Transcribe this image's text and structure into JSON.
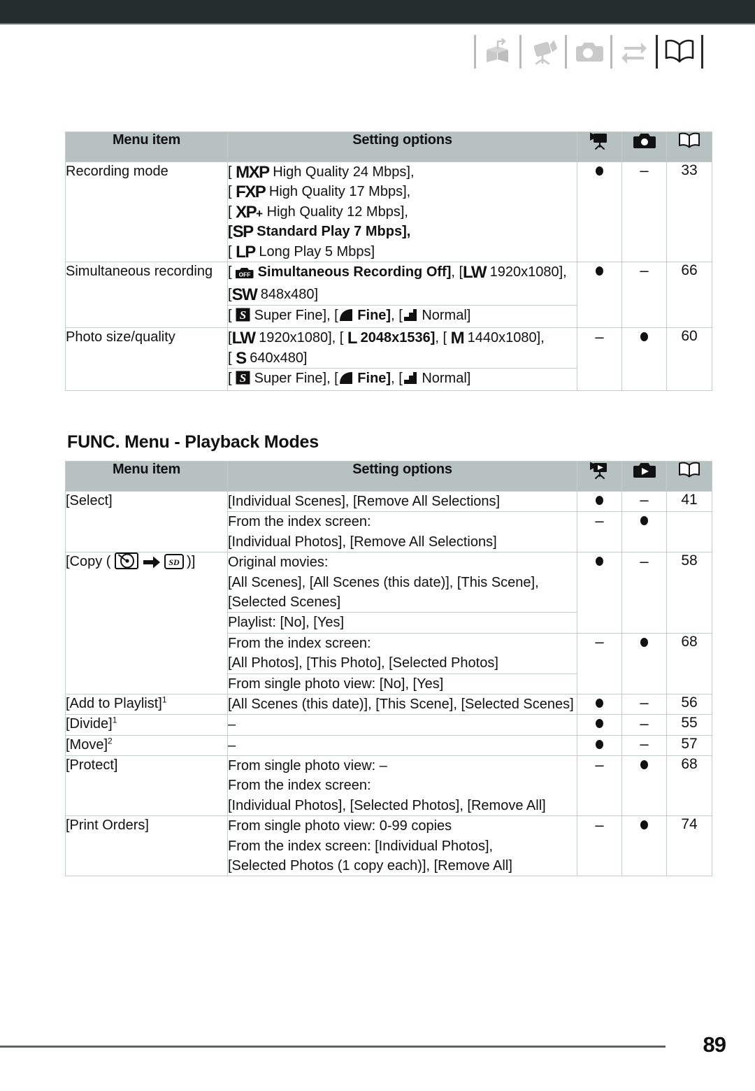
{
  "document": {
    "page_number": "89"
  },
  "header": {
    "tabs": [
      {
        "name": "open-box-icon",
        "state": "inactive"
      },
      {
        "name": "camcorder-icon",
        "state": "inactive"
      },
      {
        "name": "camera-icon",
        "state": "inactive"
      },
      {
        "name": "transfer-arrows-icon",
        "state": "inactive"
      },
      {
        "name": "open-book-icon",
        "state": "active"
      }
    ]
  },
  "table_record": {
    "columns": {
      "item": "Menu item",
      "options": "Setting options",
      "mode_movie": "camcorder-record-icon",
      "mode_photo": "camera-record-icon",
      "page": "open-book-icon"
    },
    "rows": [
      {
        "item": "Recording mode",
        "option_blocks": [
          {
            "lines": [
              {
                "parts": [
                  {
                    "t": "text",
                    "v": "[ "
                  },
                  {
                    "t": "badge",
                    "v": "MXP"
                  },
                  {
                    "t": "text",
                    "v": " High Quality 24 Mbps],"
                  }
                ]
              },
              {
                "parts": [
                  {
                    "t": "text",
                    "v": "[ "
                  },
                  {
                    "t": "badge",
                    "v": "FXP"
                  },
                  {
                    "t": "text",
                    "v": " High Quality 17 Mbps],"
                  }
                ]
              },
              {
                "parts": [
                  {
                    "t": "text",
                    "v": "[ "
                  },
                  {
                    "t": "badge",
                    "v": "XP+"
                  },
                  {
                    "t": "text",
                    "v": " High Quality 12 Mbps],"
                  }
                ]
              },
              {
                "bold": true,
                "parts": [
                  {
                    "t": "text",
                    "v": "["
                  },
                  {
                    "t": "badge",
                    "v": "SP"
                  },
                  {
                    "t": "text",
                    "v": " Standard Play 7 Mbps],"
                  }
                ]
              },
              {
                "parts": [
                  {
                    "t": "text",
                    "v": "[ "
                  },
                  {
                    "t": "badge",
                    "v": "LP"
                  },
                  {
                    "t": "text",
                    "v": " Long Play 5 Mbps]"
                  }
                ]
              }
            ]
          }
        ],
        "mode_movie": "●",
        "mode_photo": "–",
        "page": "33"
      },
      {
        "item": "Simultaneous recording",
        "option_blocks": [
          {
            "lines": [
              {
                "parts": [
                  {
                    "t": "text",
                    "v": "[ "
                  },
                  {
                    "t": "icon",
                    "v": "off-camera-icon"
                  },
                  {
                    "t": "btext",
                    "v": " Simultaneous Recording Off]"
                  },
                  {
                    "t": "text",
                    "v": ", ["
                  },
                  {
                    "t": "badge",
                    "v": "LW"
                  },
                  {
                    "t": "text",
                    "v": " 1920x1080],"
                  }
                ]
              },
              {
                "parts": [
                  {
                    "t": "text",
                    "v": "["
                  },
                  {
                    "t": "badge",
                    "v": "SW"
                  },
                  {
                    "t": "text",
                    "v": " 848x480]"
                  }
                ]
              }
            ]
          },
          {
            "lines": [
              {
                "parts": [
                  {
                    "t": "text",
                    "v": "[ "
                  },
                  {
                    "t": "icon",
                    "v": "super-fine-icon"
                  },
                  {
                    "t": "text",
                    "v": " Super Fine], ["
                  },
                  {
                    "t": "icon",
                    "v": "fine-icon"
                  },
                  {
                    "t": "btext",
                    "v": " Fine]"
                  },
                  {
                    "t": "text",
                    "v": ", ["
                  },
                  {
                    "t": "icon",
                    "v": "normal-icon"
                  },
                  {
                    "t": "text",
                    "v": " Normal]"
                  }
                ]
              }
            ]
          }
        ],
        "mode_movie": "●",
        "mode_photo": "–",
        "page": "66"
      },
      {
        "item": "Photo size/quality",
        "option_blocks": [
          {
            "lines": [
              {
                "parts": [
                  {
                    "t": "text",
                    "v": "["
                  },
                  {
                    "t": "badge",
                    "v": "LW"
                  },
                  {
                    "t": "text",
                    "v": " 1920x1080], [ "
                  },
                  {
                    "t": "badge",
                    "v": "L"
                  },
                  {
                    "t": "btext",
                    "v": " 2048x1536]"
                  },
                  {
                    "t": "text",
                    "v": ", [ "
                  },
                  {
                    "t": "badge",
                    "v": "M"
                  },
                  {
                    "t": "text",
                    "v": " 1440x1080],"
                  }
                ]
              },
              {
                "parts": [
                  {
                    "t": "text",
                    "v": "[ "
                  },
                  {
                    "t": "badge",
                    "v": "S"
                  },
                  {
                    "t": "text",
                    "v": " 640x480]"
                  }
                ]
              }
            ]
          },
          {
            "lines": [
              {
                "parts": [
                  {
                    "t": "text",
                    "v": "[ "
                  },
                  {
                    "t": "icon",
                    "v": "super-fine-icon"
                  },
                  {
                    "t": "text",
                    "v": " Super Fine], ["
                  },
                  {
                    "t": "icon",
                    "v": "fine-icon"
                  },
                  {
                    "t": "btext",
                    "v": " Fine]"
                  },
                  {
                    "t": "text",
                    "v": ", ["
                  },
                  {
                    "t": "icon",
                    "v": "normal-icon"
                  },
                  {
                    "t": "text",
                    "v": " Normal]"
                  }
                ]
              }
            ]
          }
        ],
        "mode_movie": "–",
        "mode_photo": "●",
        "page": "60"
      }
    ]
  },
  "section_playback": {
    "heading": "FUNC. Menu - Playback Modes"
  },
  "table_playback": {
    "columns": {
      "item": "Menu item",
      "options": "Setting options",
      "mode_movie": "camcorder-playback-icon",
      "mode_photo": "camera-playback-icon",
      "page": "open-book-icon"
    },
    "rows": [
      {
        "item": "[Select]",
        "groups": [
          {
            "blocks": [
              {
                "lines": [
                  {
                    "parts": [
                      {
                        "t": "text",
                        "v": "[Individual Scenes], [Remove All Selections]"
                      }
                    ]
                  }
                ]
              }
            ],
            "mode_movie": "●",
            "mode_photo": "–",
            "page": "41"
          },
          {
            "blocks": [
              {
                "lines": [
                  {
                    "parts": [
                      {
                        "t": "text",
                        "v": "From the index screen:"
                      }
                    ]
                  },
                  {
                    "parts": [
                      {
                        "t": "text",
                        "v": "[Individual Photos], [Remove All Selections]"
                      }
                    ]
                  }
                ]
              }
            ],
            "mode_movie": "–",
            "mode_photo": "●",
            "page": ""
          }
        ]
      },
      {
        "item_parts": [
          {
            "t": "text",
            "v": "[Copy ( "
          },
          {
            "t": "icon",
            "v": "hard-disk-icon"
          },
          {
            "t": "text",
            "v": " "
          },
          {
            "t": "icon",
            "v": "right-arrow-icon"
          },
          {
            "t": "text",
            "v": " "
          },
          {
            "t": "icon",
            "v": "sd-card-icon"
          },
          {
            "t": "text",
            "v": ")]"
          }
        ],
        "groups": [
          {
            "blocks": [
              {
                "lines": [
                  {
                    "parts": [
                      {
                        "t": "text",
                        "v": "Original movies:"
                      }
                    ]
                  },
                  {
                    "parts": [
                      {
                        "t": "text",
                        "v": "[All Scenes], [All Scenes (this date)], [This Scene],"
                      }
                    ]
                  },
                  {
                    "parts": [
                      {
                        "t": "text",
                        "v": "[Selected Scenes]"
                      }
                    ]
                  }
                ]
              },
              {
                "lines": [
                  {
                    "parts": [
                      {
                        "t": "text",
                        "v": "Playlist: [No], [Yes]"
                      }
                    ]
                  }
                ]
              }
            ],
            "mode_movie": "●",
            "mode_photo": "–",
            "page": "58"
          },
          {
            "blocks": [
              {
                "lines": [
                  {
                    "parts": [
                      {
                        "t": "text",
                        "v": "From the index screen:"
                      }
                    ]
                  },
                  {
                    "parts": [
                      {
                        "t": "text",
                        "v": "[All Photos], [This Photo], [Selected Photos]"
                      }
                    ]
                  }
                ]
              },
              {
                "lines": [
                  {
                    "parts": [
                      {
                        "t": "text",
                        "v": "From single photo view: [No], [Yes]"
                      }
                    ]
                  }
                ]
              }
            ],
            "mode_movie": "–",
            "mode_photo": "●",
            "page": "68"
          }
        ]
      },
      {
        "item_parts": [
          {
            "t": "text",
            "v": "[Add to Playlist]"
          },
          {
            "t": "sup",
            "v": "1"
          }
        ],
        "groups": [
          {
            "blocks": [
              {
                "lines": [
                  {
                    "parts": [
                      {
                        "t": "text",
                        "v": "[All Scenes (this date)], [This Scene], [Selected Scenes]"
                      }
                    ]
                  }
                ]
              }
            ],
            "mode_movie": "●",
            "mode_photo": "–",
            "page": "56"
          }
        ]
      },
      {
        "item_parts": [
          {
            "t": "text",
            "v": "[Divide]"
          },
          {
            "t": "sup",
            "v": "1"
          }
        ],
        "groups": [
          {
            "blocks": [
              {
                "lines": [
                  {
                    "parts": [
                      {
                        "t": "text",
                        "v": "–"
                      }
                    ]
                  }
                ]
              }
            ],
            "mode_movie": "●",
            "mode_photo": "–",
            "page": "55"
          }
        ]
      },
      {
        "item_parts": [
          {
            "t": "text",
            "v": "[Move]"
          },
          {
            "t": "sup",
            "v": "2"
          }
        ],
        "groups": [
          {
            "blocks": [
              {
                "lines": [
                  {
                    "parts": [
                      {
                        "t": "text",
                        "v": "–"
                      }
                    ]
                  }
                ]
              }
            ],
            "mode_movie": "●",
            "mode_photo": "–",
            "page": "57"
          }
        ]
      },
      {
        "item": "[Protect]",
        "groups": [
          {
            "blocks": [
              {
                "lines": [
                  {
                    "parts": [
                      {
                        "t": "text",
                        "v": "From single photo view: –"
                      }
                    ]
                  },
                  {
                    "parts": [
                      {
                        "t": "text",
                        "v": "From the index screen:"
                      }
                    ]
                  },
                  {
                    "parts": [
                      {
                        "t": "text",
                        "v": "[Individual Photos], [Selected Photos], [Remove All]"
                      }
                    ]
                  }
                ]
              }
            ],
            "mode_movie": "–",
            "mode_photo": "●",
            "page": "68"
          }
        ]
      },
      {
        "item": "[Print Orders]",
        "groups": [
          {
            "blocks": [
              {
                "lines": [
                  {
                    "parts": [
                      {
                        "t": "text",
                        "v": "From single photo view: 0-99 copies"
                      }
                    ]
                  },
                  {
                    "parts": [
                      {
                        "t": "text",
                        "v": "From the index screen: [Individual Photos],"
                      }
                    ]
                  },
                  {
                    "parts": [
                      {
                        "t": "text",
                        "v": "[Selected Photos (1 copy each)], [Remove All]"
                      }
                    ]
                  }
                ]
              }
            ],
            "mode_movie": "–",
            "mode_photo": "●",
            "page": "74"
          }
        ]
      }
    ]
  },
  "colors": {
    "topbar": "#252c2c",
    "table_header": "#b7c2c0",
    "grid_line": "#c3cecb",
    "text": "#111111",
    "tab_inactive": "#c9c9c9",
    "tab_active": "#1b1b1b"
  }
}
